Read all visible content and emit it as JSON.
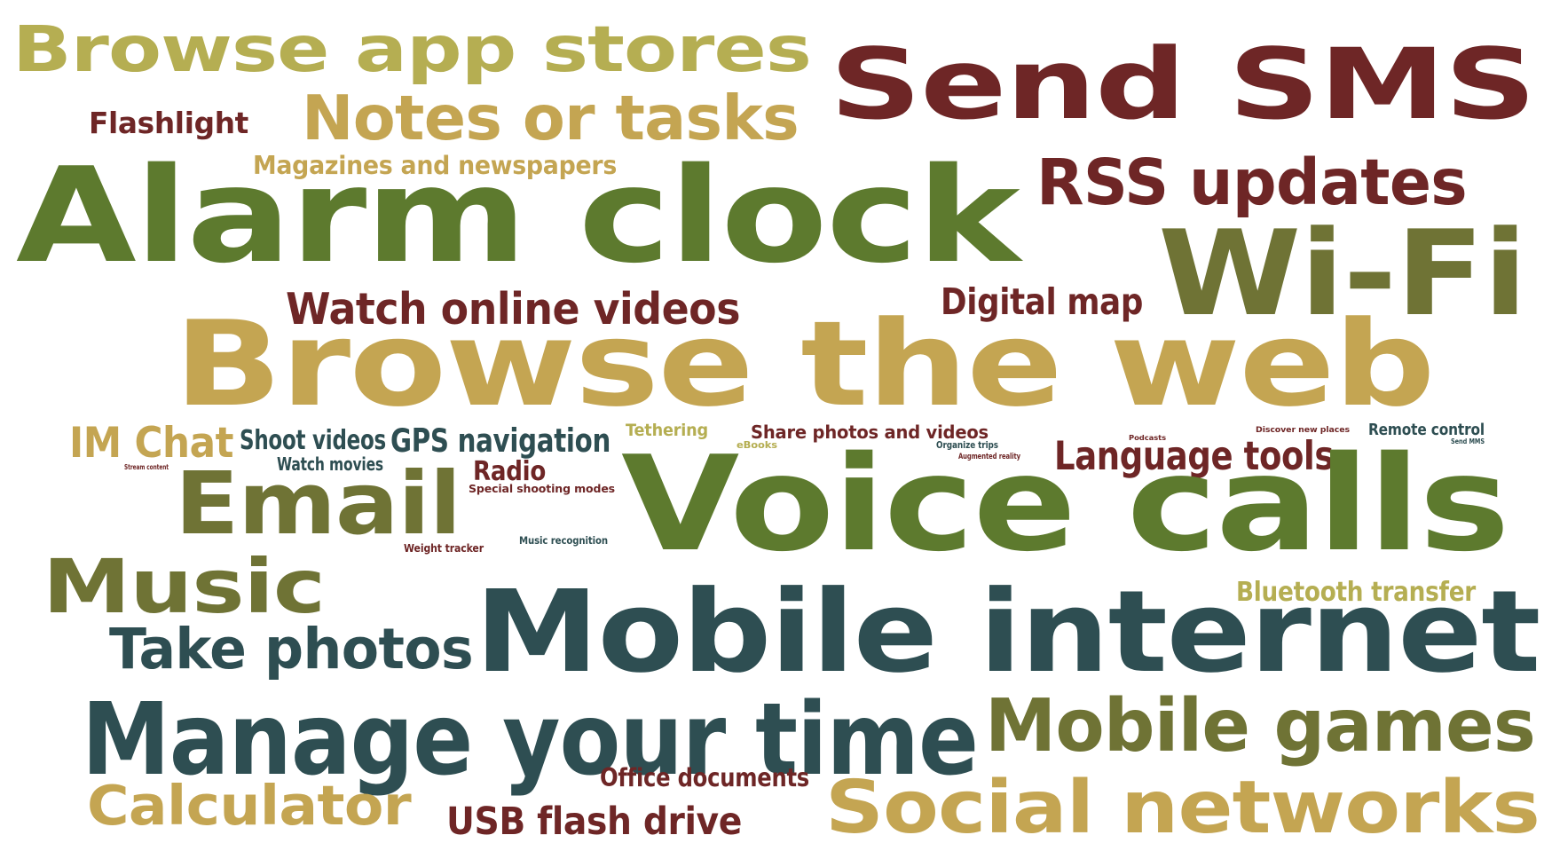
{
  "palette": {
    "olive_light": "#b5ae52",
    "gold": "#c4a552",
    "maroon": "#6e2626",
    "green": "#5d7a2e",
    "dark_olive": "#6f7335",
    "teal": "#2e4e52"
  },
  "words": [
    {
      "text": "Browse app stores",
      "color": "olive_light"
    },
    {
      "text": "Send SMS",
      "color": "maroon"
    },
    {
      "text": "Flashlight",
      "color": "maroon"
    },
    {
      "text": "Notes or tasks",
      "color": "gold"
    },
    {
      "text": "Magazines and newspapers",
      "color": "gold"
    },
    {
      "text": "Alarm clock",
      "color": "green"
    },
    {
      "text": "RSS updates",
      "color": "maroon"
    },
    {
      "text": "Wi-Fi",
      "color": "dark_olive"
    },
    {
      "text": "Watch online videos",
      "color": "maroon"
    },
    {
      "text": "Digital map",
      "color": "maroon"
    },
    {
      "text": "Browse the web",
      "color": "gold"
    },
    {
      "text": "IM Chat",
      "color": "gold"
    },
    {
      "text": "Shoot videos",
      "color": "teal"
    },
    {
      "text": "GPS navigation",
      "color": "teal"
    },
    {
      "text": "Tethering",
      "color": "olive_light"
    },
    {
      "text": "Share photos and videos",
      "color": "maroon"
    },
    {
      "text": "Remote control",
      "color": "teal"
    },
    {
      "text": "Language tools",
      "color": "maroon"
    },
    {
      "text": "Watch movies",
      "color": "teal"
    },
    {
      "text": "Radio",
      "color": "maroon"
    },
    {
      "text": "Email",
      "color": "dark_olive"
    },
    {
      "text": "Voice calls",
      "color": "green"
    },
    {
      "text": "Special shooting modes",
      "color": "maroon"
    },
    {
      "text": "Weight tracker",
      "color": "maroon"
    },
    {
      "text": "Music recognition",
      "color": "teal"
    },
    {
      "text": "eBooks",
      "color": "olive_light"
    },
    {
      "text": "Organize trips",
      "color": "teal"
    },
    {
      "text": "Augmented reality",
      "color": "maroon"
    },
    {
      "text": "Podcasts",
      "color": "maroon"
    },
    {
      "text": "Discover new places",
      "color": "maroon"
    },
    {
      "text": "Send MMS",
      "color": "teal"
    },
    {
      "text": "Stream content",
      "color": "maroon"
    },
    {
      "text": "Music",
      "color": "dark_olive"
    },
    {
      "text": "Bluetooth transfer",
      "color": "olive_light"
    },
    {
      "text": "Mobile internet",
      "color": "teal"
    },
    {
      "text": "Take photos",
      "color": "teal"
    },
    {
      "text": "Manage your time",
      "color": "teal"
    },
    {
      "text": "Mobile games",
      "color": "dark_olive"
    },
    {
      "text": "Office documents",
      "color": "maroon"
    },
    {
      "text": "Calculator",
      "color": "gold"
    },
    {
      "text": "USB flash drive",
      "color": "maroon"
    },
    {
      "text": "Social networks",
      "color": "gold"
    }
  ]
}
